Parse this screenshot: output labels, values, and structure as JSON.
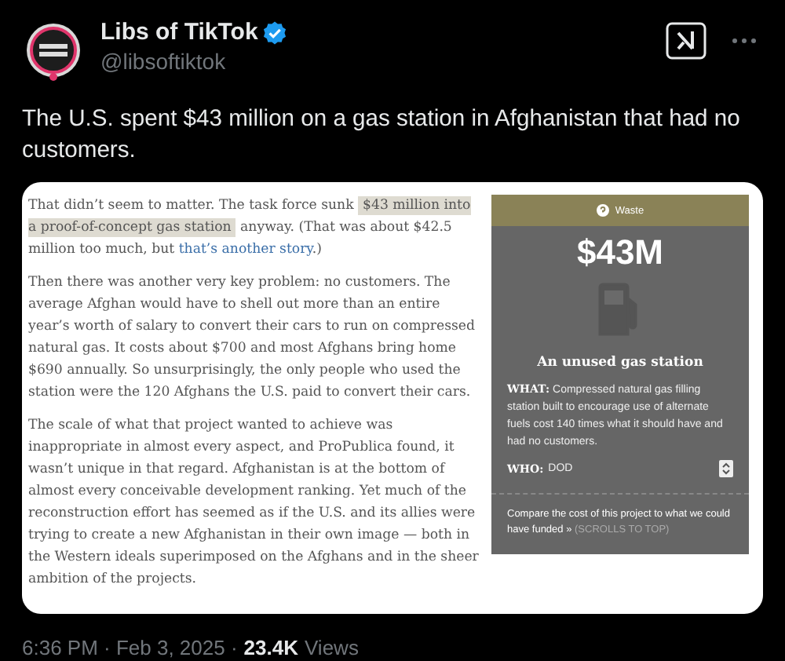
{
  "tweet": {
    "author": {
      "name": "Libs of TikTok",
      "verified": true,
      "handle": "@libsoftiktok"
    },
    "text": "The U.S. spent $43 million on a gas station in Afghanistan that had no customers.",
    "image": {
      "paragraphs": [
        {
          "parts": [
            {
              "kind": "plain",
              "text": "That didn’t seem to matter. The task force sunk "
            },
            {
              "kind": "highlight",
              "text": "$43 million into a proof-of-concept gas station"
            },
            {
              "kind": "plain",
              "text": " anyway. (That was about $42.5 million too much, but "
            },
            {
              "kind": "link",
              "text": "that’s another story"
            },
            {
              "kind": "plain",
              "text": ".)"
            }
          ]
        },
        {
          "parts": [
            {
              "kind": "plain",
              "text": "Then there was another very key problem: no customers. The average Afghan would have to shell out more than an entire year’s worth of salary to convert their cars to run on compressed natural gas. It costs about $700 and most Afghans bring home $690 annually. So unsurprisingly, the only people who used the station were the 120 Afghans the U.S. paid to convert their cars."
            }
          ]
        },
        {
          "parts": [
            {
              "kind": "plain",
              "text": "The scale of what that project wanted to achieve was inappropriate in almost every aspect, and ProPublica found, it wasn’t unique in that regard. Afghanistan is at the bottom of almost every conceivable development ranking. Yet much of the reconstruction effort has seemed as if the U.S. and its allies were trying to create a new Afghanistan in their own image — both in the Western ideals superimposed on the Afghans and in the sheer ambition of the projects."
            }
          ]
        }
      ],
      "panel": {
        "category": "Waste",
        "amount": "$43M",
        "title": "An unused gas station",
        "what_label": "WHAT:",
        "what_text": "Compressed natural gas filling station built to encourage use of alternate fuels cost 140 times what it should have and had no customers.",
        "who_label": "WHO:",
        "who_text": "DOD",
        "compare": "Compare the cost of this project to what we could have funded »",
        "compare_hint": "(SCROLLS TO TOP)"
      }
    },
    "timestamp": "6:36 PM · Feb 3, 2025 · ",
    "views": "23.4K",
    "views_label": "Views"
  }
}
